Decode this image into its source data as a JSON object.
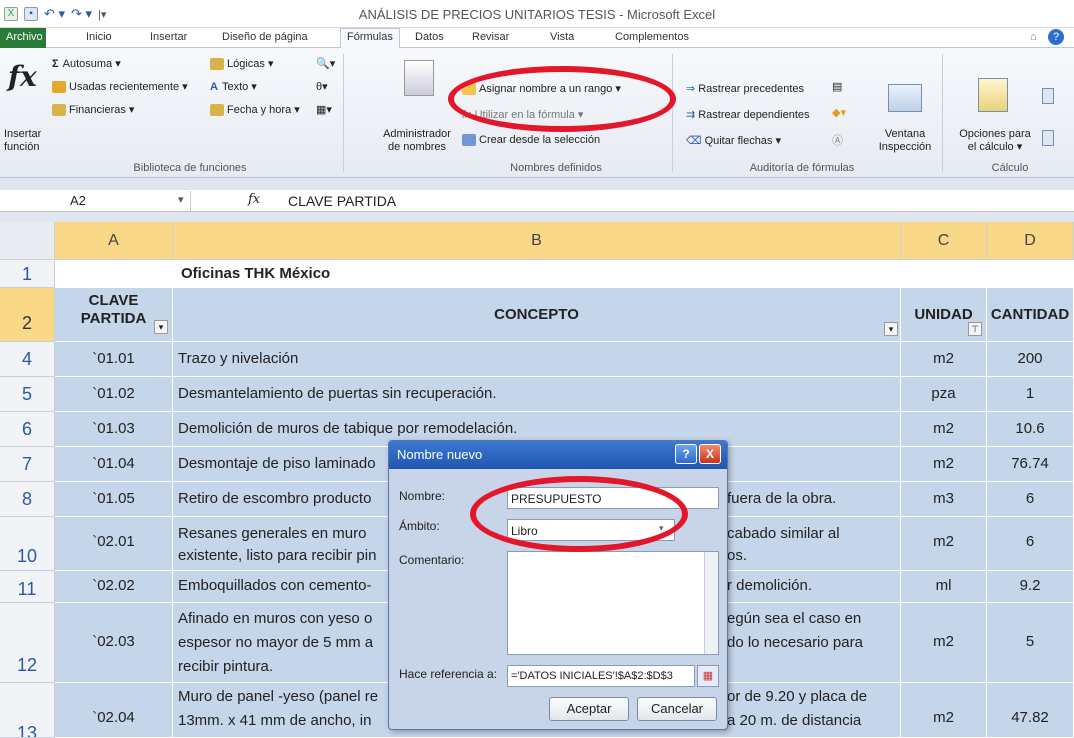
{
  "window": {
    "title": "ANÁLISIS DE PRECIOS UNITARIOS TESIS  -  Microsoft Excel"
  },
  "tabs": {
    "archivo": "Archivo",
    "inicio": "Inicio",
    "insertar": "Insertar",
    "diseno": "Diseño de página",
    "formulas": "Fórmulas",
    "datos": "Datos",
    "revisar": "Revisar",
    "vista": "Vista",
    "complementos": "Complementos"
  },
  "ribbon": {
    "insertar_funcion": [
      "Insertar",
      "función"
    ],
    "autosuma": "Autosuma ▾",
    "usadas": "Usadas recientemente ▾",
    "financieras": "Financieras ▾",
    "logicas": "Lógicas ▾",
    "texto": "Texto ▾",
    "fecha": "Fecha y hora ▾",
    "grp_biblioteca": "Biblioteca de funciones",
    "administrador": [
      "Administrador",
      "de nombres"
    ],
    "asignar": "Asignar nombre a un rango ▾",
    "utilizar": "Utilizar en la fórmula ▾",
    "crear": "Crear desde la selección",
    "grp_nombres": "Nombres definidos",
    "rastrear_prec": "Rastrear precedentes",
    "rastrear_dep": "Rastrear dependientes",
    "quitar": "Quitar flechas ▾",
    "grp_auditoria": "Auditoría de fórmulas",
    "ventana": [
      "Ventana",
      "Inspección"
    ],
    "opciones": [
      "Opciones para",
      "el cálculo ▾"
    ],
    "grp_calculo": "Cálculo"
  },
  "formula_bar": {
    "namebox": "A2",
    "fx": "fx",
    "content": "CLAVE PARTIDA"
  },
  "columns": [
    "A",
    "B",
    "C",
    "D"
  ],
  "header_row": {
    "num": "1",
    "b": "Oficinas THK México"
  },
  "titles_row": {
    "num": "2",
    "a": [
      "CLAVE",
      "PARTIDA"
    ],
    "b": "CONCEPTO",
    "c": "UNIDAD",
    "d": "CANTIDAD"
  },
  "rows": [
    {
      "num": "4",
      "a": "`01.01",
      "b": [
        "Trazo y nivelación"
      ],
      "c": "m2",
      "d": "200"
    },
    {
      "num": "5",
      "a": "`01.02",
      "b": [
        "Desmantelamiento de puertas sin recuperación."
      ],
      "c": "pza",
      "d": "1"
    },
    {
      "num": "6",
      "a": "`01.03",
      "b": [
        "Demolición de muros de tabique por remodelación."
      ],
      "c": "m2",
      "d": "10.6"
    },
    {
      "num": "7",
      "a": "`01.04",
      "b": [
        "Desmontaje de piso laminado"
      ],
      "c": "m2",
      "d": "76.74"
    },
    {
      "num": "8",
      "a": "`01.05",
      "b": [
        "Retiro de escombro producto",
        "fuera de la obra."
      ],
      "c": "m3",
      "d": "6"
    },
    {
      "num": "10",
      "a": "`02.01",
      "b": [
        "Resanes generales en  muro",
        "existente, listo para recibir pin",
        "cabado similar al",
        "os."
      ],
      "c": "m2",
      "d": "6"
    },
    {
      "num": "11",
      "a": "`02.02",
      "b": [
        "Emboquillados con cemento-",
        "r demolición."
      ],
      "c": "ml",
      "d": "9.2"
    },
    {
      "num": "12",
      "a": "`02.03",
      "b": [
        "Afinado en muros con yeso o",
        "espesor no mayor de 5 mm a",
        "recibir pintura.",
        "egún sea el caso en",
        "do lo necesario para"
      ],
      "c": "m2",
      "d": "5"
    },
    {
      "num": "13",
      "a": "`02.04",
      "b": [
        "Muro de panel -yeso (panel re",
        "13mm. x 41 mm de ancho, in",
        "or de 9.20 y placa de",
        "a 20 m. de distancia"
      ],
      "c": "m2",
      "d": "47.82"
    }
  ],
  "dialog": {
    "title": "Nombre nuevo",
    "nombre_label": "Nombre:",
    "nombre_value": "PRESUPUESTO",
    "ambito_label": "Ámbito:",
    "ambito_value": "Libro",
    "comentario_label": "Comentario:",
    "referencia_label": "Hace referencia a:",
    "referencia_value": "='DATOS INICIALES'!$A$2:$D$3",
    "aceptar": "Aceptar",
    "cancelar": "Cancelar",
    "help": "?",
    "close": "X"
  },
  "colors": {
    "annotation": "#e3162a",
    "selection": "#c5d5ea",
    "header_highlight": "#f9d888"
  }
}
